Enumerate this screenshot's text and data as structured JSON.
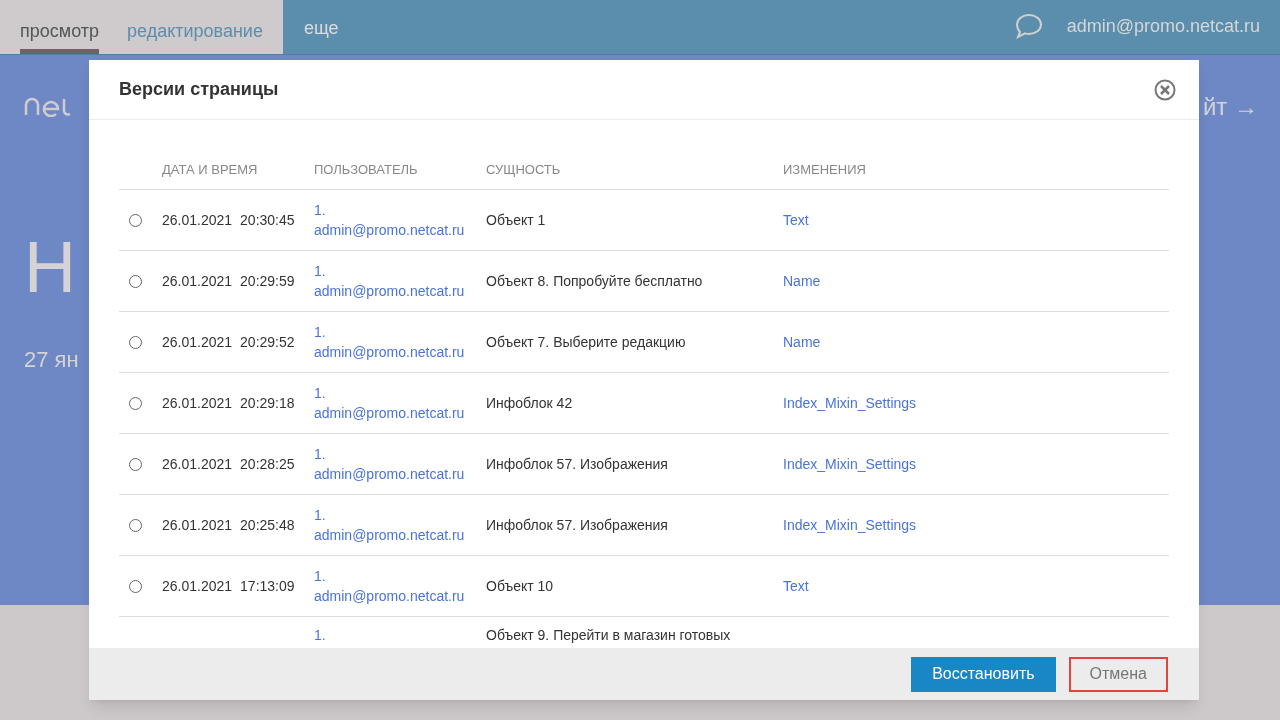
{
  "top_bar": {
    "tabs": [
      {
        "label": "просмотр",
        "selected": true
      },
      {
        "label": "редактирование",
        "selected": false
      }
    ],
    "more": "еще",
    "user": "admin@promo.netcat.ru"
  },
  "background": {
    "heading": "Н",
    "date": "27 ян",
    "link": "йт →"
  },
  "dialog": {
    "title": "Версии страницы",
    "columns": [
      "ДАТА И ВРЕМЯ",
      "ПОЛЬЗОВАТЕЛЬ",
      "СУЩНОСТЬ",
      "ИЗМЕНЕНИЯ"
    ],
    "rows": [
      {
        "selected": false,
        "date": "26.01.2021",
        "time": "20:30:45",
        "user": "1. admin@promo.netcat.ru",
        "entity": "Объект 1",
        "changes": "Text"
      },
      {
        "selected": false,
        "date": "26.01.2021",
        "time": "20:29:59",
        "user": "1. admin@promo.netcat.ru",
        "entity": "Объект 8. Попробуйте бесплатно",
        "changes": "Name"
      },
      {
        "selected": false,
        "date": "26.01.2021",
        "time": "20:29:52",
        "user": "1. admin@promo.netcat.ru",
        "entity": "Объект 7. Выберите редакцию",
        "changes": "Name"
      },
      {
        "selected": false,
        "date": "26.01.2021",
        "time": "20:29:18",
        "user": "1. admin@promo.netcat.ru",
        "entity": "Инфоблок 42",
        "changes": "Index_Mixin_Settings"
      },
      {
        "selected": false,
        "date": "26.01.2021",
        "time": "20:28:25",
        "user": "1. admin@promo.netcat.ru",
        "entity": "Инфоблок 57. Изображения",
        "changes": "Index_Mixin_Settings"
      },
      {
        "selected": false,
        "date": "26.01.2021",
        "time": "20:25:48",
        "user": "1. admin@promo.netcat.ru",
        "entity": "Инфоблок 57. Изображения",
        "changes": "Index_Mixin_Settings"
      },
      {
        "selected": false,
        "date": "26.01.2021",
        "time": "17:13:09",
        "user": "1. admin@promo.netcat.ru",
        "entity": "Объект 10",
        "changes": "Text"
      },
      {
        "user": "1.",
        "entity": "Объект 9. Перейти в магазин готовых"
      }
    ],
    "buttons": [
      {
        "kind": "primary",
        "label": "Восстановить"
      },
      {
        "kind": "secondary",
        "label": "Отмена"
      }
    ]
  }
}
